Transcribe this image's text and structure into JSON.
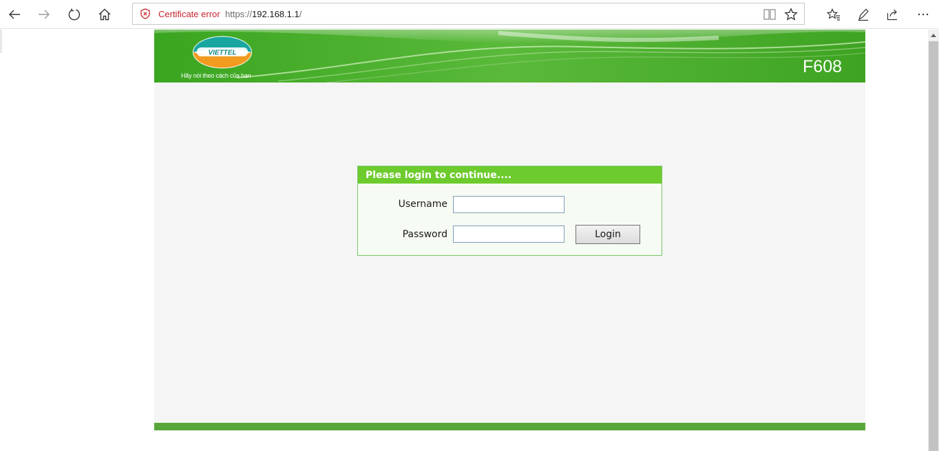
{
  "browser": {
    "cert_error": "Certificate error",
    "url_scheme": "https://",
    "url_host": "192.168.1.1",
    "url_path": "/"
  },
  "banner": {
    "logo_text": "VIETTEL",
    "slogan": "Hãy nói theo cách của bạn",
    "model": "F608"
  },
  "login": {
    "header": "Please login to continue....",
    "username_label": "Username",
    "username_value": "",
    "password_label": "Password",
    "password_value": "",
    "login_button": "Login"
  },
  "colors": {
    "banner_green": "#3fa624",
    "header_green": "#6dcb2e",
    "footer_green": "#58a73a",
    "cert_error_red": "#c9222b"
  }
}
